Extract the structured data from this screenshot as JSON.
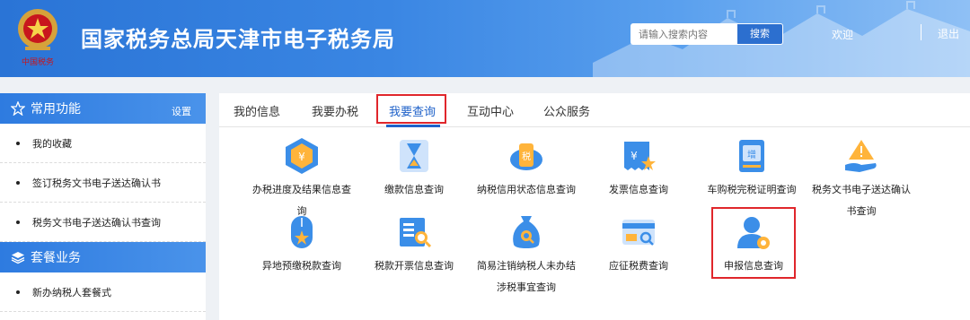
{
  "header": {
    "title": "国家税务总局天津市电子税务局",
    "search_placeholder": "请输入搜索内容",
    "search_button": "搜索",
    "welcome": "欢迎",
    "logout": "退出"
  },
  "sidebar": {
    "common": {
      "title": "常用功能",
      "settings": "设置",
      "items": [
        "我的收藏",
        "签订税务文书电子送达确认书",
        "税务文书电子送达确认书查询"
      ]
    },
    "package": {
      "title": "套餐业务",
      "items": [
        "新办纳税人套餐式"
      ]
    }
  },
  "tabs": [
    {
      "label": "我的信息",
      "active": false
    },
    {
      "label": "我要办税",
      "active": false
    },
    {
      "label": "我要查询",
      "active": true
    },
    {
      "label": "互动中心",
      "active": false
    },
    {
      "label": "公众服务",
      "active": false
    }
  ],
  "tiles": [
    {
      "label_lines": [
        "办税进度及结果信息查",
        "询"
      ],
      "icon": "progress-query-icon"
    },
    {
      "label_lines": [
        "缴款信息查询"
      ],
      "icon": "hourglass-icon"
    },
    {
      "label_lines": [
        "纳税信用状态信息查询"
      ],
      "icon": "credit-icon"
    },
    {
      "label_lines": [
        "发票信息查询"
      ],
      "icon": "invoice-icon"
    },
    {
      "label_lines": [
        "车购税完税证明查询"
      ],
      "icon": "vehicle-tax-icon"
    },
    {
      "label_lines": [
        "税务文书电子送达确认",
        "书查询"
      ],
      "icon": "warning-hand-icon"
    },
    {
      "label_lines": [
        "异地预缴税款查询"
      ],
      "icon": "mouse-icon"
    },
    {
      "label_lines": [
        "税款开票信息查询"
      ],
      "icon": "receipt-search-icon"
    },
    {
      "label_lines": [
        "简易注销纳税人未办结",
        "涉税事宜查询"
      ],
      "icon": "money-bag-search-icon"
    },
    {
      "label_lines": [
        "应征税费查询"
      ],
      "icon": "card-search-icon"
    },
    {
      "label_lines": [
        "申报信息查询"
      ],
      "icon": "user-gear-icon"
    }
  ],
  "colors": {
    "brand_blue": "#2a74d6",
    "active_tab": "#1f62c9",
    "highlight_red": "#e0262b"
  }
}
